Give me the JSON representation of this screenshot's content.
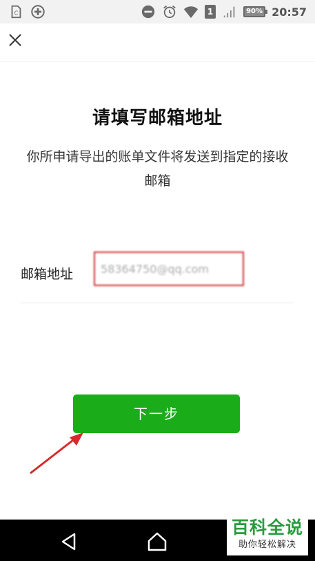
{
  "status_bar": {
    "time": "20:57",
    "battery_text": "90%",
    "battery_level": 0.9,
    "sim_label": "1",
    "icons": [
      "sim-card-icon",
      "add-circle-icon",
      "do-not-disturb-icon",
      "alarm-icon",
      "wifi-icon",
      "signal-icon",
      "battery-icon"
    ]
  },
  "header": {
    "close_icon": "close-icon"
  },
  "main": {
    "title": "请填写邮箱地址",
    "description": "你所申请导出的账单文件将发送到指定的接收邮箱",
    "email_label": "邮箱地址",
    "email_value": "58364750@qq.com",
    "next_label": "下一步"
  },
  "nav_bar": {
    "icons": [
      "back-icon",
      "home-icon"
    ]
  },
  "watermark": {
    "main": "百科全说",
    "sub": "助你轻松解决"
  },
  "colors": {
    "primary_green": "#1aad19",
    "highlight_red": "#cc3333",
    "watermark_green": "#2a9c3e"
  }
}
